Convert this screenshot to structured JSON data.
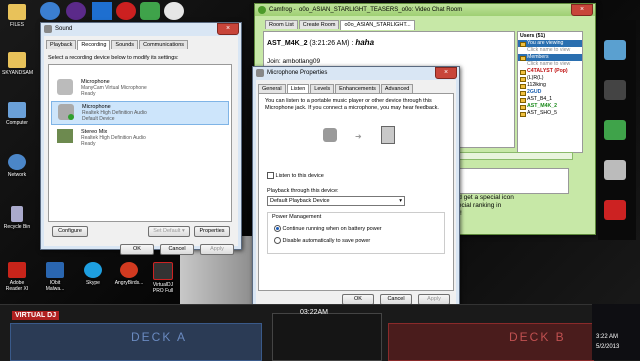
{
  "desktop": {
    "icons_left": [
      {
        "label": "FILES"
      },
      {
        "label": "SKYANDSAM"
      },
      {
        "label": "Computer"
      },
      {
        "label": "Network"
      },
      {
        "label": "Recycle Bin"
      }
    ],
    "icons_bottom": [
      {
        "label": "Adobe Reader XI"
      },
      {
        "label": "IObit Malwa..."
      },
      {
        "label": "Skype"
      },
      {
        "label": "AngryBirds..."
      },
      {
        "label": "VirtualDJ PRO Full"
      }
    ]
  },
  "sound": {
    "title": "Sound",
    "tabs": [
      "Playback",
      "Recording",
      "Sounds",
      "Communications"
    ],
    "instruction": "Select a recording device below to modify its settings:",
    "devices": [
      {
        "name": "Microphone",
        "l1": "ManyCam Virtual Microphone",
        "l2": "Ready"
      },
      {
        "name": "Microphone",
        "l1": "Realtek High Definition Audio",
        "l2": "Default Device"
      },
      {
        "name": "Stereo Mix",
        "l1": "Realtek High Definition Audio",
        "l2": "Ready"
      }
    ],
    "configure": "Configure",
    "set_default": "Set Default",
    "properties": "Properties",
    "ok": "OK",
    "cancel": "Cancel",
    "apply": "Apply"
  },
  "mic": {
    "title": "Microphone Properties",
    "tabs": [
      "General",
      "Listen",
      "Levels",
      "Enhancements",
      "Advanced"
    ],
    "desc": "You can listen to a portable music player or other device through this Microphone jack. If you connect a microphone, you may hear feedback.",
    "listen_label": "Listen to this device",
    "playback_label": "Playback through this device:",
    "playback_value": "Default Playback Device",
    "power_group": "Power Management",
    "power_opt1": "Continue running when on battery power",
    "power_opt2": "Disable automatically to save power",
    "ok": "OK",
    "cancel": "Cancel",
    "apply": "Apply"
  },
  "chat": {
    "title": "Camfrog -  o0o_ASIAN_STARLIGHT_TEASERS_o0o: Video Chat Room",
    "app_label": "Camfrog",
    "tabs": [
      "Room List",
      "Create Room",
      "o0o_ASIAN_STARLIGHT..."
    ],
    "msg1_user": "AST_M4K_2",
    "msg1_time": "(3:21:26 AM) :",
    "msg1_text": "haha",
    "join_label": "Join:",
    "join_user": "ambotlang09",
    "users_header": "Users (51)",
    "you_viewing": "You are viewing",
    "click_view": "Click name to view",
    "members": "Members",
    "member_list": [
      "C4TALYST (Pop)",
      "(L)R(L)",
      "112łking",
      "2GUD",
      "AST_B4_1",
      "AST_M4K_2",
      "AST_SHO_5"
    ],
    "promo_line1": "and get a special icon",
    "promo_line2": "special ranking in",
    "promo_line3": "ver!"
  },
  "vdj": {
    "logo": "VIRTUAL DJ",
    "deck_a": "DECK A",
    "deck_b": "DECK B",
    "time": "03:22AM"
  },
  "tray": {
    "time": "3:22 AM",
    "date": "5/2/2013"
  },
  "colors": {
    "win_frame": "#d9e6f4",
    "chat_frame": "#c7e8a7",
    "deck_a": "#3a5a8a",
    "deck_b": "#8a2a2a"
  }
}
